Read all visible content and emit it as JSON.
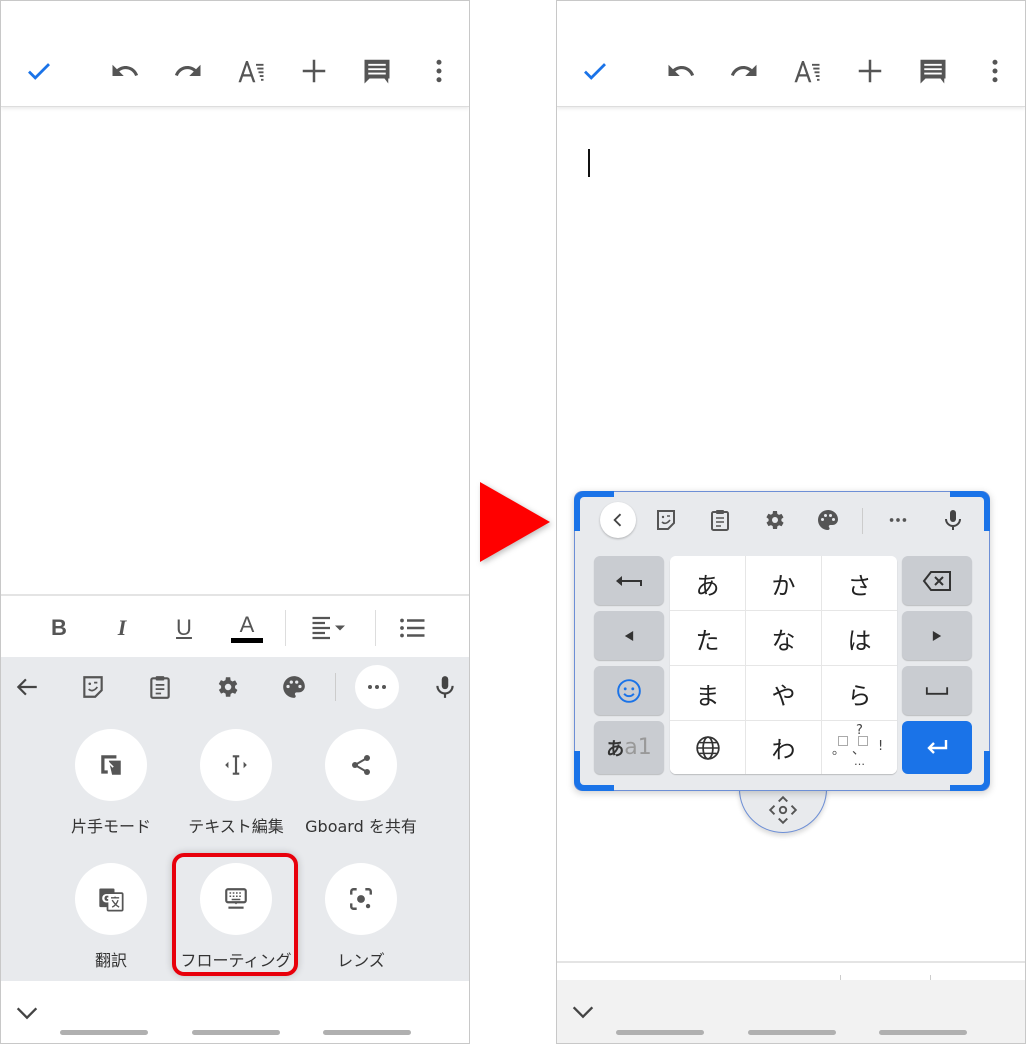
{
  "left_screen": {
    "appbar": {
      "icons": [
        "check-icon",
        "undo-icon",
        "redo-icon",
        "text-format-icon",
        "add-icon",
        "comment-icon",
        "more-vert-icon"
      ],
      "accent_color": "#1a73e8"
    },
    "format_toolbar": {
      "icons": [
        "bold-icon",
        "italic-icon",
        "underline-icon",
        "text-color-icon",
        "align-icon",
        "bulleted-list-icon"
      ],
      "bold": "B",
      "italic": "I",
      "underline": "U",
      "text_color": "A"
    },
    "keyboard_toolbar": {
      "icons": [
        "back-arrow-icon",
        "sticker-icon",
        "clipboard-icon",
        "settings-icon",
        "palette-icon",
        "more-horiz-icon",
        "mic-icon"
      ]
    },
    "gboard_menu": {
      "items": [
        {
          "label": "片手モード",
          "icon": "one-handed-icon"
        },
        {
          "label": "テキスト編集",
          "icon": "text-edit-icon"
        },
        {
          "label": "Gboard を共有",
          "icon": "share-icon"
        },
        {
          "label": "翻訳",
          "icon": "translate-icon"
        },
        {
          "label": "フローティング",
          "icon": "floating-keyboard-icon",
          "highlighted": true
        },
        {
          "label": "レンズ",
          "icon": "lens-icon"
        }
      ],
      "highlight_color": "#e8000b"
    }
  },
  "transition_arrow": {
    "color": "#ff0000"
  },
  "right_screen": {
    "appbar": {
      "icons": [
        "check-icon",
        "undo-icon",
        "redo-icon",
        "text-format-icon",
        "add-icon",
        "comment-icon",
        "more-vert-icon"
      ]
    },
    "floating_keyboard": {
      "toolbar_icons": [
        "collapse-icon",
        "sticker-icon",
        "clipboard-icon",
        "settings-icon",
        "palette-icon",
        "more-horiz-icon",
        "mic-icon"
      ],
      "kana_keys": [
        "あ",
        "か",
        "さ",
        "た",
        "な",
        "は",
        "ま",
        "や",
        "ら",
        "",
        "わ",
        ""
      ],
      "punct_key": {
        "top": "?",
        "middle": "。、!",
        "bottom": "…",
        "left": "。",
        "center": "、",
        "right": "!"
      },
      "mode_key": {
        "primary": "あ",
        "secondary": "a1"
      },
      "border_color": "#1a73e8",
      "enter_color": "#1a73e8"
    }
  }
}
